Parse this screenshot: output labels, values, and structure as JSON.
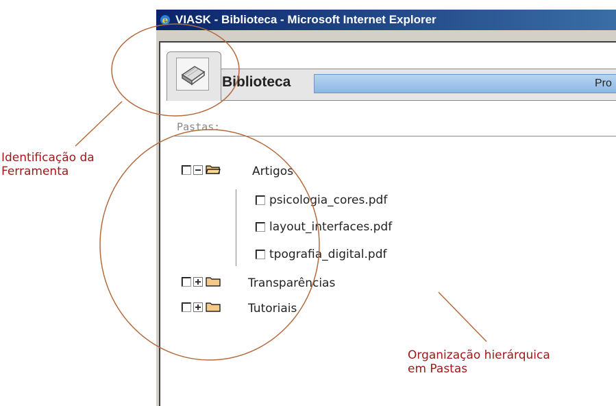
{
  "window": {
    "title": "VIASK - Biblioteca - Microsoft Internet Explorer"
  },
  "tool": {
    "name": "Biblioteca",
    "banner_text": "Pro",
    "icon": "book-icon"
  },
  "folders_section": {
    "label": "Pastas:"
  },
  "tree": {
    "folders": [
      {
        "name": "Artigos",
        "expanded": true,
        "files": [
          "psicologia_cores.pdf",
          "layout_interfaces.pdf",
          "tpografia_digital.pdf"
        ]
      },
      {
        "name": "Transparências",
        "expanded": false
      },
      {
        "name": "Tutoriais",
        "expanded": false
      }
    ]
  },
  "annotations": {
    "tool_id": [
      "Identificação da",
      "Ferramenta"
    ],
    "hierarchy": [
      "Organização hierárquica",
      "em Pastas"
    ]
  },
  "colors": {
    "annotation": "#a01818",
    "ellipse": "#b46a3c",
    "titlebar": "#0a246a",
    "banner": "#8cb8e6"
  }
}
